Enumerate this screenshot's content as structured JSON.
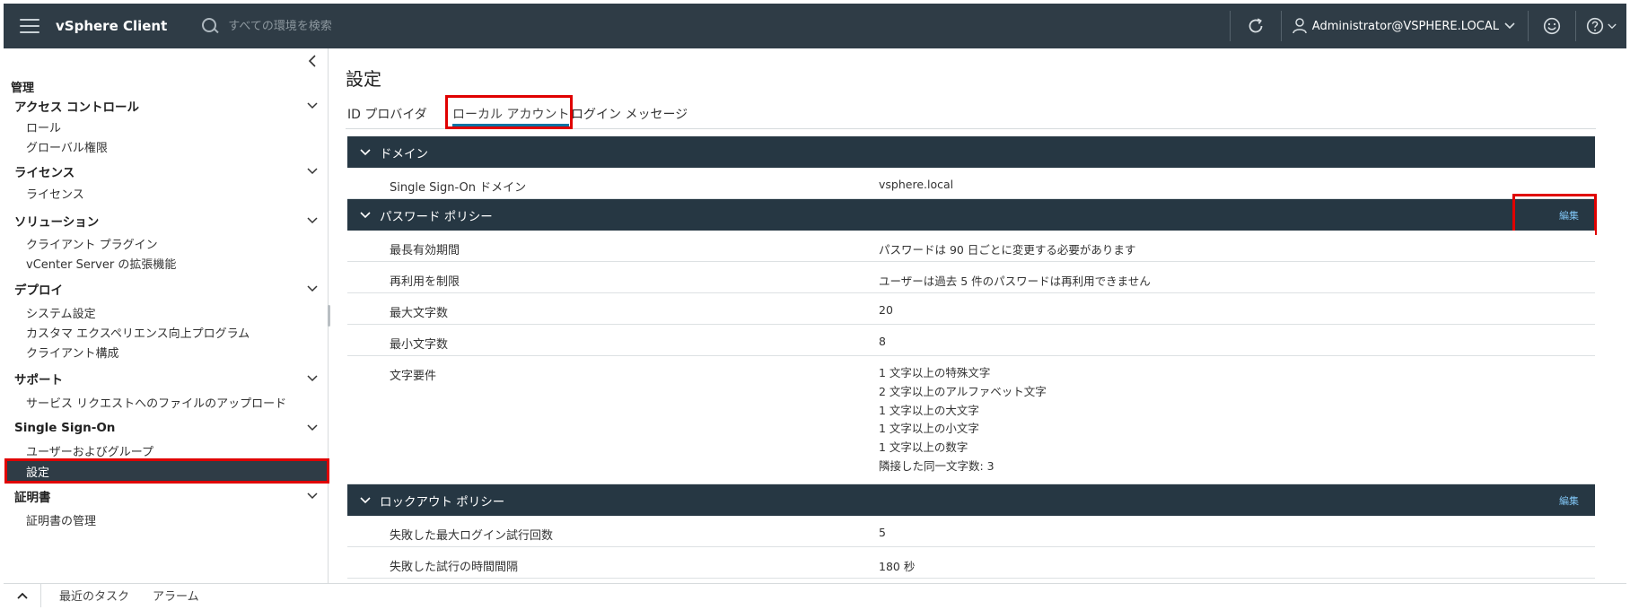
{
  "header": {
    "app_title": "vSphere Client",
    "search_placeholder": "すべての環境を検索",
    "user_name": "Administrator@VSPHERE.LOCAL",
    "icons": [
      "menu-icon",
      "search-icon",
      "refresh-icon",
      "user-icon",
      "chevron-down-icon",
      "smiley-icon",
      "help-icon"
    ]
  },
  "sidebar": {
    "title": "管理",
    "groups": [
      {
        "label": "アクセス コントロール",
        "items": [
          "ロール",
          "グローバル権限"
        ]
      },
      {
        "label": "ライセンス",
        "items": [
          "ライセンス"
        ]
      },
      {
        "label": "ソリューション",
        "items": [
          "クライアント プラグイン",
          "vCenter Server の拡張機能"
        ]
      },
      {
        "label": "デプロイ",
        "items": [
          "システム設定",
          "カスタマ エクスペリエンス向上プログラム",
          "クライアント構成"
        ]
      },
      {
        "label": "サポート",
        "items": [
          "サービス リクエストへのファイルのアップロード"
        ]
      },
      {
        "label": "Single Sign-On",
        "items": [
          "ユーザーおよびグループ",
          "設定"
        ]
      },
      {
        "label": "証明書",
        "items": [
          "証明書の管理"
        ]
      }
    ],
    "selected_item": "設定"
  },
  "main": {
    "title": "設定",
    "tabs": [
      {
        "label": "ID プロバイダ",
        "active": false
      },
      {
        "label": "ローカル アカウント",
        "active": true
      },
      {
        "label": "ログイン メッセージ",
        "active": false
      }
    ],
    "sections": {
      "domain": {
        "title": "ドメイン",
        "rows": [
          {
            "label": "Single Sign-On ドメイン",
            "value": "vsphere.local"
          }
        ]
      },
      "password_policy": {
        "title": "パスワード ポリシー",
        "edit_label": "編集",
        "rows": [
          {
            "label": "最長有効期間",
            "value": "パスワードは 90 日ごとに変更する必要があります"
          },
          {
            "label": "再利用を制限",
            "value": "ユーザーは過去 5 件のパスワードは再利用できません"
          },
          {
            "label": "最大文字数",
            "value": "20"
          },
          {
            "label": "最小文字数",
            "value": "8"
          }
        ],
        "char_requirements": {
          "label": "文字要件",
          "values": [
            "1 文字以上の特殊文字",
            "2 文字以上のアルファベット文字",
            "1 文字以上の大文字",
            "1 文字以上の小文字",
            "1 文字以上の数字",
            "隣接した同一文字数: 3"
          ]
        }
      },
      "lockout_policy": {
        "title": "ロックアウト ポリシー",
        "edit_label": "編集",
        "rows": [
          {
            "label": "失敗した最大ログイン試行回数",
            "value": "5"
          },
          {
            "label": "失敗した試行の時間間隔",
            "value": "180 秒"
          }
        ]
      }
    }
  },
  "bottombar": {
    "tabs": [
      "最近のタスク",
      "アラーム"
    ]
  },
  "colors": {
    "header_bg": "#2f3c46",
    "section_header_bg": "#263743",
    "active_tab_underline": "#0072a3",
    "edit_link": "#7fc3f2",
    "highlight_red": "#e00000"
  }
}
